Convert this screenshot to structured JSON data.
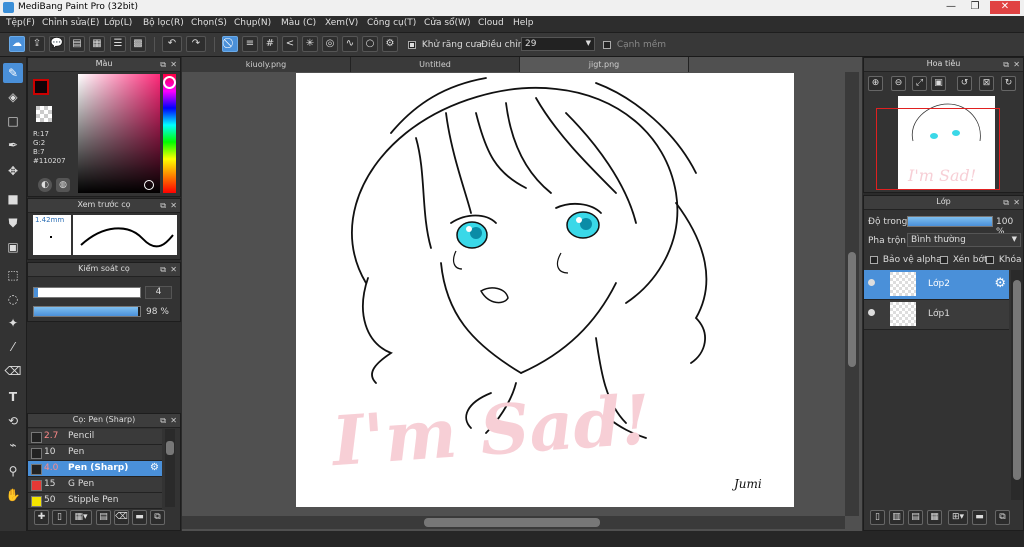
{
  "window": {
    "title": "MediBang Paint Pro (32bit)",
    "min": "—",
    "max": "❐",
    "close": "✕"
  },
  "menu": [
    "Tệp(F)",
    "Chỉnh sửa(E)",
    "Lớp(L)",
    "Bộ lọc(R)",
    "Chọn(S)",
    "Chụp(N)",
    "Màu (C)",
    "Xem(V)",
    "Công cụ(T)",
    "Cửa sổ(W)",
    "Cloud",
    "Help"
  ],
  "toolbar": {
    "antialias": "Khử răng cưa",
    "correction": "Điều chỉnh",
    "correction_value": "29",
    "edge": "Cạnh mềm"
  },
  "panels": {
    "color": {
      "title": "Màu",
      "r": "R:17",
      "g": "G:2",
      "b": "B:7",
      "hex": "#110207",
      "fg": "#110207"
    },
    "brush_preview": {
      "title": "Xem trước cọ",
      "size": "1.42mm"
    },
    "brush_control": {
      "title": "Kiểm soát cọ",
      "size_value": "4",
      "opacity_value": "98 %",
      "opacity_fraction": 0.98,
      "size_fraction": 0.95
    },
    "brush_list": {
      "title": "Cọ: Pen (Sharp)",
      "items": [
        {
          "size": "2.7",
          "name": "Pencil",
          "swatch": "#222222",
          "hl": false
        },
        {
          "size": "10",
          "name": "Pen",
          "swatch": "#222222",
          "hl": false
        },
        {
          "size": "4.0",
          "name": "Pen (Sharp)",
          "swatch": "#222222",
          "hl": true
        },
        {
          "size": "15",
          "name": "G Pen",
          "swatch": "#e53935",
          "hl": false
        },
        {
          "size": "50",
          "name": "Stipple Pen",
          "swatch": "#f4e400",
          "hl": false
        }
      ]
    },
    "navigator": {
      "title": "Hoa tiêu"
    },
    "layers": {
      "title": "Lớp",
      "opacity_label": "Độ trong",
      "opacity_value": "100 %",
      "opacity_fraction": 1.0,
      "blend_label": "Pha trộn",
      "blend_value": "Bình thường",
      "protect_alpha": "Bảo vệ alpha",
      "clip": "Xén bớt",
      "lock": "Khóa",
      "items": [
        {
          "name": "Lớp2",
          "active": true
        },
        {
          "name": "Lớp1",
          "active": false
        }
      ]
    }
  },
  "tabs": [
    "kiuoly.png",
    "Untitled",
    "jigt.png"
  ],
  "canvas_text": {
    "watermark": "I'm Sad!",
    "signature": "Jumi"
  },
  "colors": {
    "accent": "#4a90d9",
    "watermark": "#f7cfd6",
    "eye": "#3ad8e8"
  }
}
